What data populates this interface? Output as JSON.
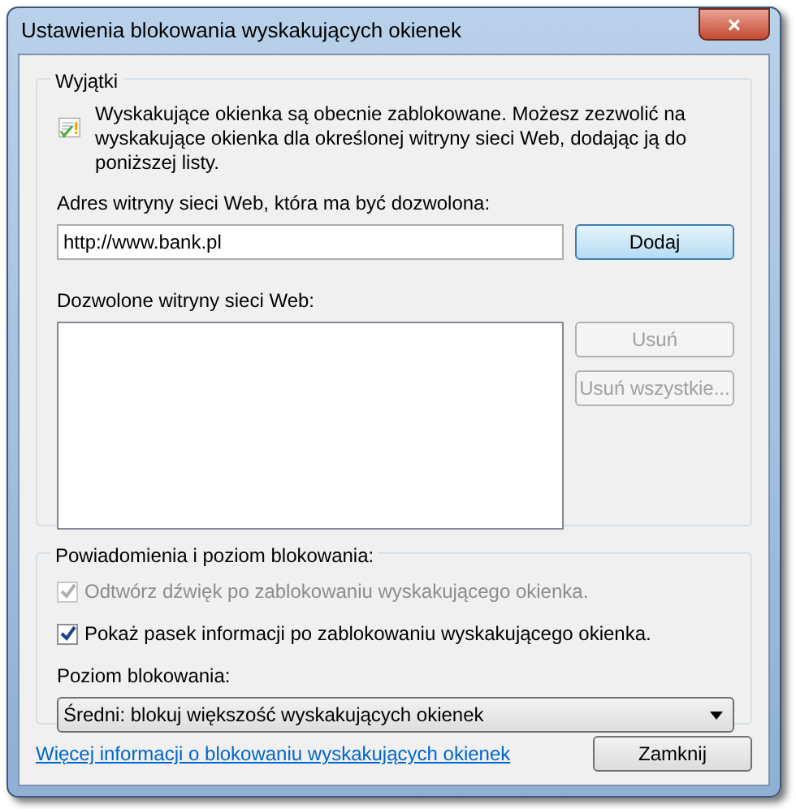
{
  "window": {
    "title": "Ustawienia blokowania wyskakujących okienek",
    "close": "×"
  },
  "exceptions": {
    "legend": "Wyjątki",
    "info": "Wyskakujące okienka są obecnie zablokowane. Możesz zezwolić na wyskakujące okienka dla określonej witryny sieci Web, dodając ją do poniższej listy.",
    "address_label": "Adres witryny sieci Web, która ma być dozwolona:",
    "address_value": "http://www.bank.pl",
    "add_button": {
      "label": "Dodaj",
      "disabled": false
    },
    "allowed_label": "Dozwolone witryny sieci Web:",
    "side_buttons": [
      {
        "label": "Usuń",
        "disabled": true
      },
      {
        "label": "Usuń wszystkie...",
        "disabled": true
      }
    ]
  },
  "notifications": {
    "legend": "Powiadomienia i poziom blokowania:",
    "options": [
      {
        "label": "Odtwórz dźwięk po zablokowaniu wyskakującego okienka.",
        "checked": true,
        "disabled": true
      },
      {
        "label": "Pokaż pasek informacji po zablokowaniu wyskakującego okienka.",
        "checked": true,
        "disabled": false
      }
    ],
    "level_label": "Poziom blokowania:",
    "level_value": "Średni: blokuj większość wyskakujących okienek"
  },
  "footer": {
    "link": "Więcej informacji o blokowaniu wyskakujących okienek",
    "close_button": "Zamknij"
  }
}
